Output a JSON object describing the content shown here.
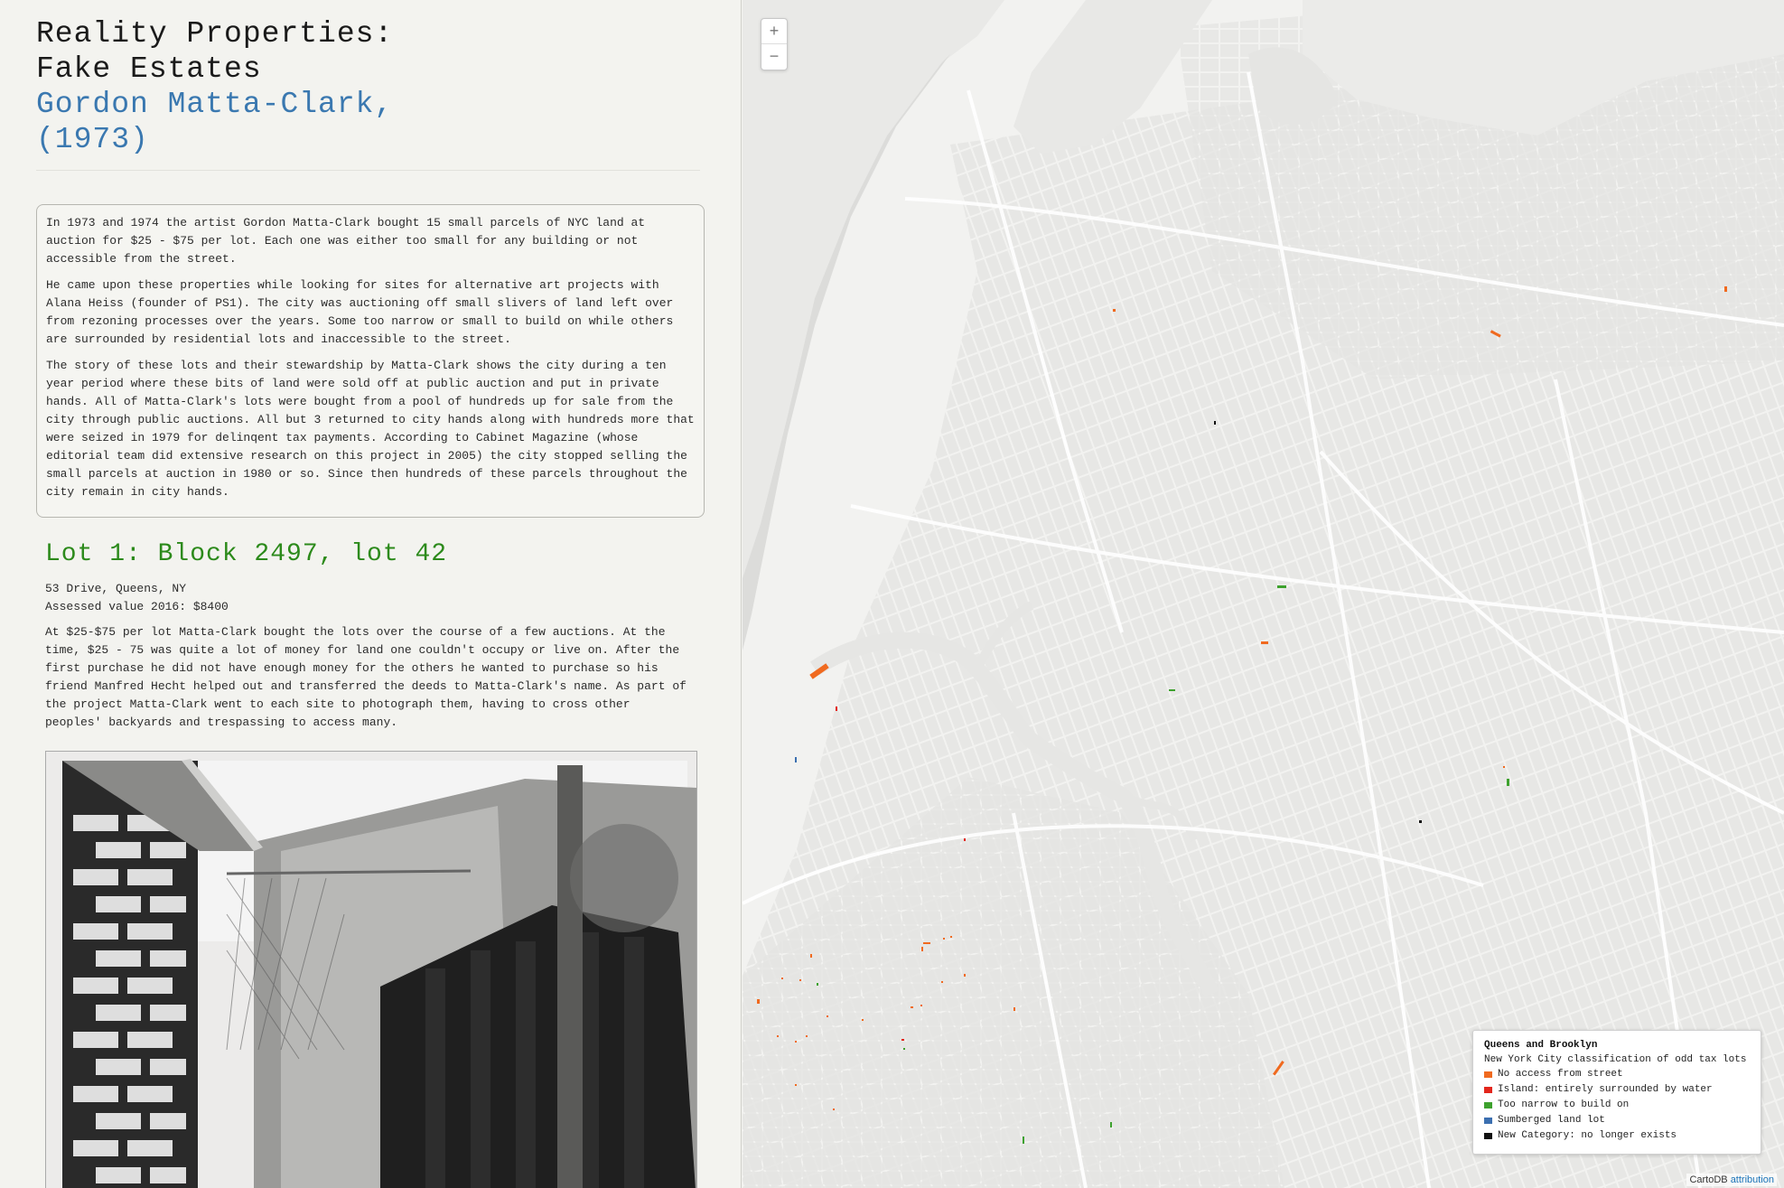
{
  "sidebar": {
    "title_line1": "Reality Properties:",
    "title_line2": "Fake Estates",
    "artist_line1": "Gordon Matta-Clark,",
    "artist_line2": "(1973)",
    "intro_paragraphs": [
      "In 1973 and 1974 the artist Gordon Matta-Clark bought 15 small parcels of NYC land at auction for $25 - $75 per lot. Each one was either too small for any building or not accessible from the street.",
      "He came upon these properties while looking for sites for alternative art projects with Alana Heiss (founder of PS1). The city was auctioning off small slivers of land left over from rezoning processes over the years. Some too narrow or small to build on while others are surrounded by residential lots and inaccessible to the street.",
      "The story of these lots and their stewardship by Matta-Clark shows the city during a ten year period where these bits of land were sold off at public auction and put in private hands. All of Matta-Clark's lots were bought from a pool of hundreds up for sale from the city through public auctions. All but 3 returned to city hands along with hundreds more that were seized in 1979 for delinqent tax payments. According to Cabinet Magazine (whose editorial team did extensive research on this project in 2005) the city stopped selling the small parcels at auction in 1980 or so. Since then hundreds of these parcels throughout the city remain in city hands."
    ],
    "lot": {
      "heading": "Lot 1: Block 2497, lot 42",
      "address": "53 Drive, Queens, NY",
      "assessed": "Assessed value 2016: $8400",
      "description": "At $25-$75 per lot Matta-Clark bought the lots over the course of a few auctions. At the time, $25 - 75 was quite a lot of money for land one couldn't occupy or live on. After the first purchase he did not have enough money for the others he wanted to purchase so his friend Manfred Hecht helped out and transferred the deeds to Matta-Clark's name. As part of the project Matta-Clark went to each site to photograph them, having to cross other peoples' backyards and trespassing to access many."
    }
  },
  "map": {
    "zoom_in": "+",
    "zoom_out": "−",
    "legend": {
      "title": "Queens and Brooklyn",
      "subtitle": "New York City classification of odd tax lots",
      "items": [
        {
          "label": "No access from street",
          "color": "#f06a1f"
        },
        {
          "label": "Island: entirely surrounded by water",
          "color": "#e3261c"
        },
        {
          "label": "Too narrow to build on",
          "color": "#3da12d"
        },
        {
          "label": "Sumberged land lot",
          "color": "#3b6fb0"
        },
        {
          "label": "New Category: no longer exists",
          "color": "#111111"
        }
      ]
    },
    "attribution_prefix": "CartoDB",
    "attribution_link": "attribution"
  }
}
